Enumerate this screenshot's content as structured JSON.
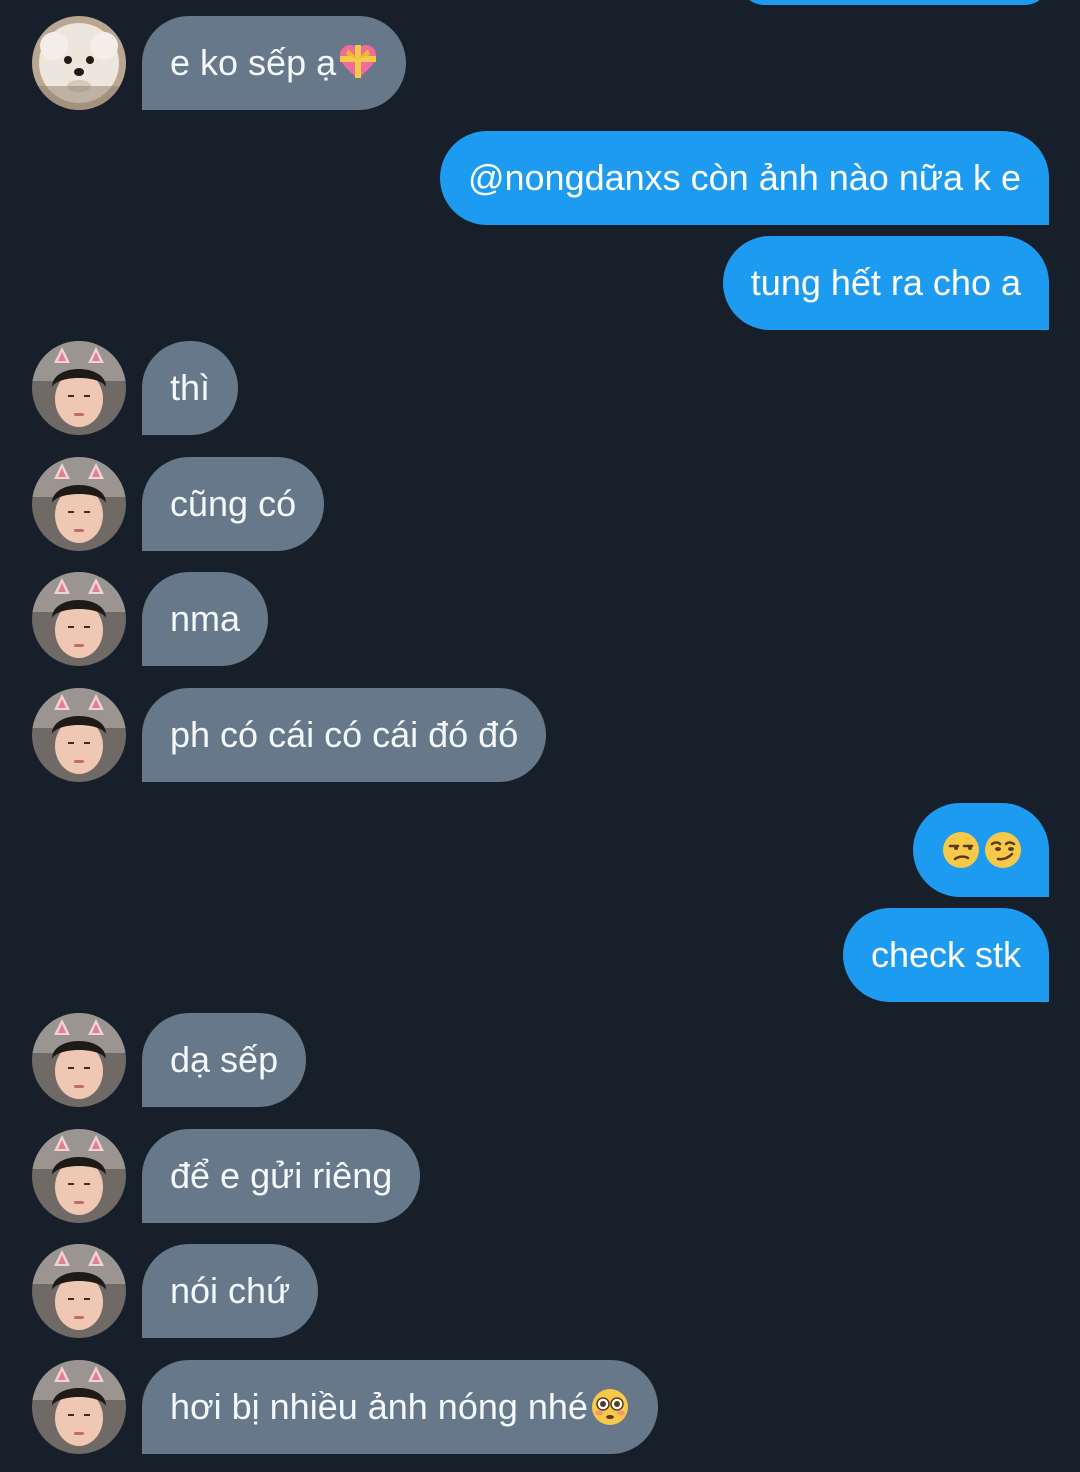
{
  "conversation": {
    "messages": [
      {
        "side": "in",
        "avatar": "dog",
        "text": "e ko sếp ạ",
        "emoji": "heart-with-ribbon"
      },
      {
        "side": "out",
        "text": "@nongdanxs còn ảnh nào nữa k e"
      },
      {
        "side": "out",
        "text": "tung hết ra cho a"
      },
      {
        "side": "in",
        "avatar": "boy",
        "text": "thì"
      },
      {
        "side": "in",
        "avatar": "boy",
        "text": "cũng có"
      },
      {
        "side": "in",
        "avatar": "boy",
        "text": "nma"
      },
      {
        "side": "in",
        "avatar": "boy",
        "text": "ph có cái có cái đó đó"
      },
      {
        "side": "out",
        "emoji": [
          "unamused-face",
          "smirking-face"
        ]
      },
      {
        "side": "out",
        "text": "check stk"
      },
      {
        "side": "in",
        "avatar": "boy",
        "text": "dạ sếp"
      },
      {
        "side": "in",
        "avatar": "boy",
        "text": "để e gửi riêng"
      },
      {
        "side": "in",
        "avatar": "boy",
        "text": "nói chứ"
      },
      {
        "side": "in",
        "avatar": "boy",
        "text": "hơi bị nhiều ảnh nóng nhé",
        "emoji": "flushed-face"
      }
    ]
  },
  "colors": {
    "background": "#17202a",
    "incoming_bubble": "#66788a",
    "outgoing_bubble": "#1d9bf0",
    "text": "#f5f8fa"
  }
}
